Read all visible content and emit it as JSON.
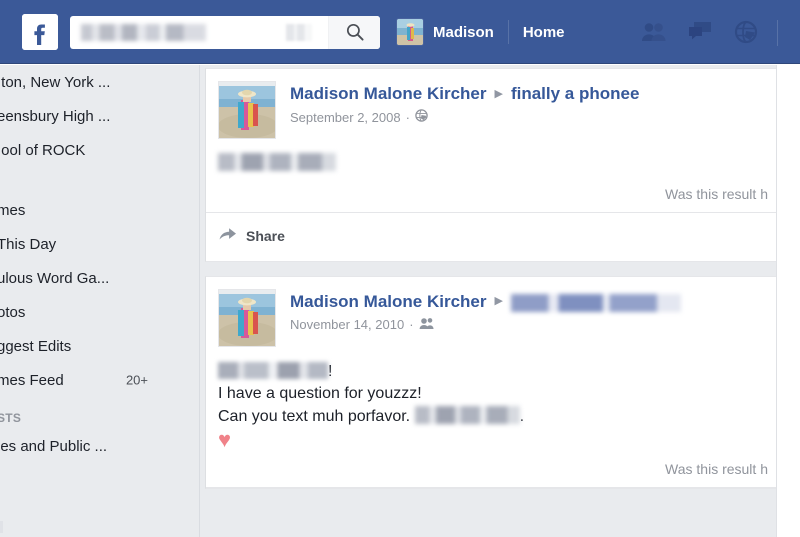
{
  "header": {
    "logo_icon": "facebook-f-logo",
    "search": {
      "value": "",
      "placeholder": "",
      "redacted": true,
      "icon": "search-icon"
    },
    "profile_name": "Madison",
    "home_label": "Home",
    "avatar_icon": "profile-thumbnail",
    "icons": [
      {
        "name": "friend-requests-icon",
        "glyph": "friends"
      },
      {
        "name": "messages-icon",
        "glyph": "messages"
      },
      {
        "name": "notifications-icon",
        "glyph": "globe"
      }
    ],
    "background_color": "#3b5998"
  },
  "sidebar": {
    "items": [
      {
        "label": "ıton, New York ...",
        "badge": ""
      },
      {
        "label": "eensbury High ...",
        "badge": ""
      },
      {
        "label": "ıool of ROCK",
        "badge": ""
      }
    ],
    "items2": [
      {
        "label": "mes",
        "badge": ""
      },
      {
        "label": "This Day",
        "badge": ""
      },
      {
        "label": "ulous Word Ga...",
        "badge": ""
      },
      {
        "label": "otos",
        "badge": ""
      },
      {
        "label": "ggest Edits",
        "badge": ""
      },
      {
        "label": "mes Feed",
        "badge": "20+"
      }
    ],
    "section_label": "STS",
    "items3": [
      {
        "label": "jes and Public ...",
        "badge": ""
      }
    ],
    "background_color": "#e9ebee"
  },
  "feed": {
    "posts": [
      {
        "avatar_icon": "post-author-avatar",
        "author": "Madison Malone Kircher",
        "caret": "▶",
        "target": "finally a phonee",
        "target_redacted": false,
        "date": "September 2, 2008",
        "separator": "·",
        "audience_icon": "globe-public-icon",
        "body_redacted": true,
        "body_lines": [],
        "heart": "",
        "result_prompt": "Was this result h",
        "share_label": "Share",
        "share_icon": "share-arrow-icon",
        "has_share": true
      },
      {
        "avatar_icon": "post-author-avatar",
        "author": "Madison Malone Kircher",
        "caret": "▶",
        "target": "",
        "target_redacted": true,
        "date": "November 14, 2010",
        "separator": "·",
        "audience_icon": "friends-icon",
        "body_redacted": true,
        "body_lines": [
          "I have a question for youzzz!",
          "Can you text muh porfavor."
        ],
        "body_line_suffix": ".",
        "body_first_suffix": "!",
        "heart": "♥",
        "result_prompt": "Was this result h",
        "share_label": "",
        "share_icon": "",
        "has_share": false
      }
    ]
  },
  "colors": {
    "fb_blue": "#3b5998",
    "link_blue": "#365899",
    "page_bg": "#e9ebee",
    "text_dark": "#1d2129",
    "text_muted": "#90949c",
    "heart_red": "#f08289"
  }
}
